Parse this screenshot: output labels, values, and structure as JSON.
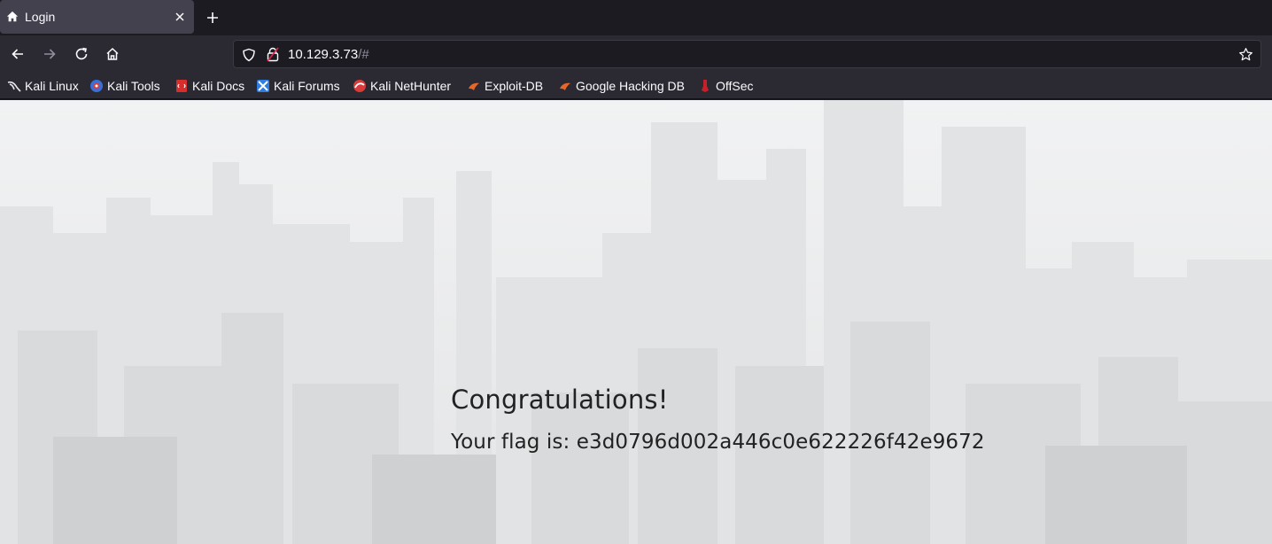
{
  "browser": {
    "tab": {
      "title": "Login",
      "icon": "home-icon"
    },
    "url": {
      "host": "10.129.3.73",
      "path": "/#"
    }
  },
  "bookmarks": [
    {
      "label": "Kali Linux",
      "icon": "kali-dragon-icon"
    },
    {
      "label": "Kali Tools",
      "icon": "kali-tools-icon"
    },
    {
      "label": "Kali Docs",
      "icon": "kali-docs-icon"
    },
    {
      "label": "Kali Forums",
      "icon": "kali-forums-icon"
    },
    {
      "label": "Kali NetHunter",
      "icon": "kali-nethunter-icon"
    },
    {
      "label": "Exploit-DB",
      "icon": "exploit-db-icon"
    },
    {
      "label": "Google Hacking DB",
      "icon": "ghdb-icon"
    },
    {
      "label": "OffSec",
      "icon": "offsec-icon"
    }
  ],
  "page": {
    "heading": "Congratulations!",
    "flag_line": "Your flag is: e3d0796d002a446c0e622226f42e9672"
  },
  "colors": {
    "chrome_dark": "#1c1b22",
    "chrome": "#2b2a33",
    "tab_active": "#42414d",
    "page_bg": "#e9eaeb",
    "text": "#222222"
  }
}
